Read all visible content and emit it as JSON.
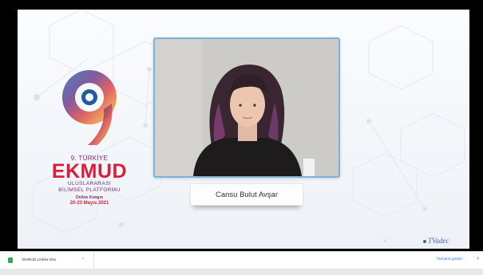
{
  "slide": {
    "logo": {
      "edition": "9. TÜRKİYE",
      "title": "EKMUD",
      "subtitle_line1": "ULUSLARARASI",
      "subtitle_line2": "BİLİMSEL PLATFORMU",
      "online": "Online Kongre",
      "dates": "20-23 Mayıs 2021"
    },
    "speaker_name": "Cansu Bulut Avşar",
    "brand": "TVadec"
  },
  "download_bar": {
    "file_name": "EKMUD Linkler.xlsx",
    "caret": "^",
    "show_all": "Tümünü göster",
    "close": "×"
  },
  "colors": {
    "logo_red": "#d81f3a",
    "logo_purple": "#7b2b6e",
    "frame_border": "#7ab2d8",
    "link_blue": "#1a73e8"
  }
}
